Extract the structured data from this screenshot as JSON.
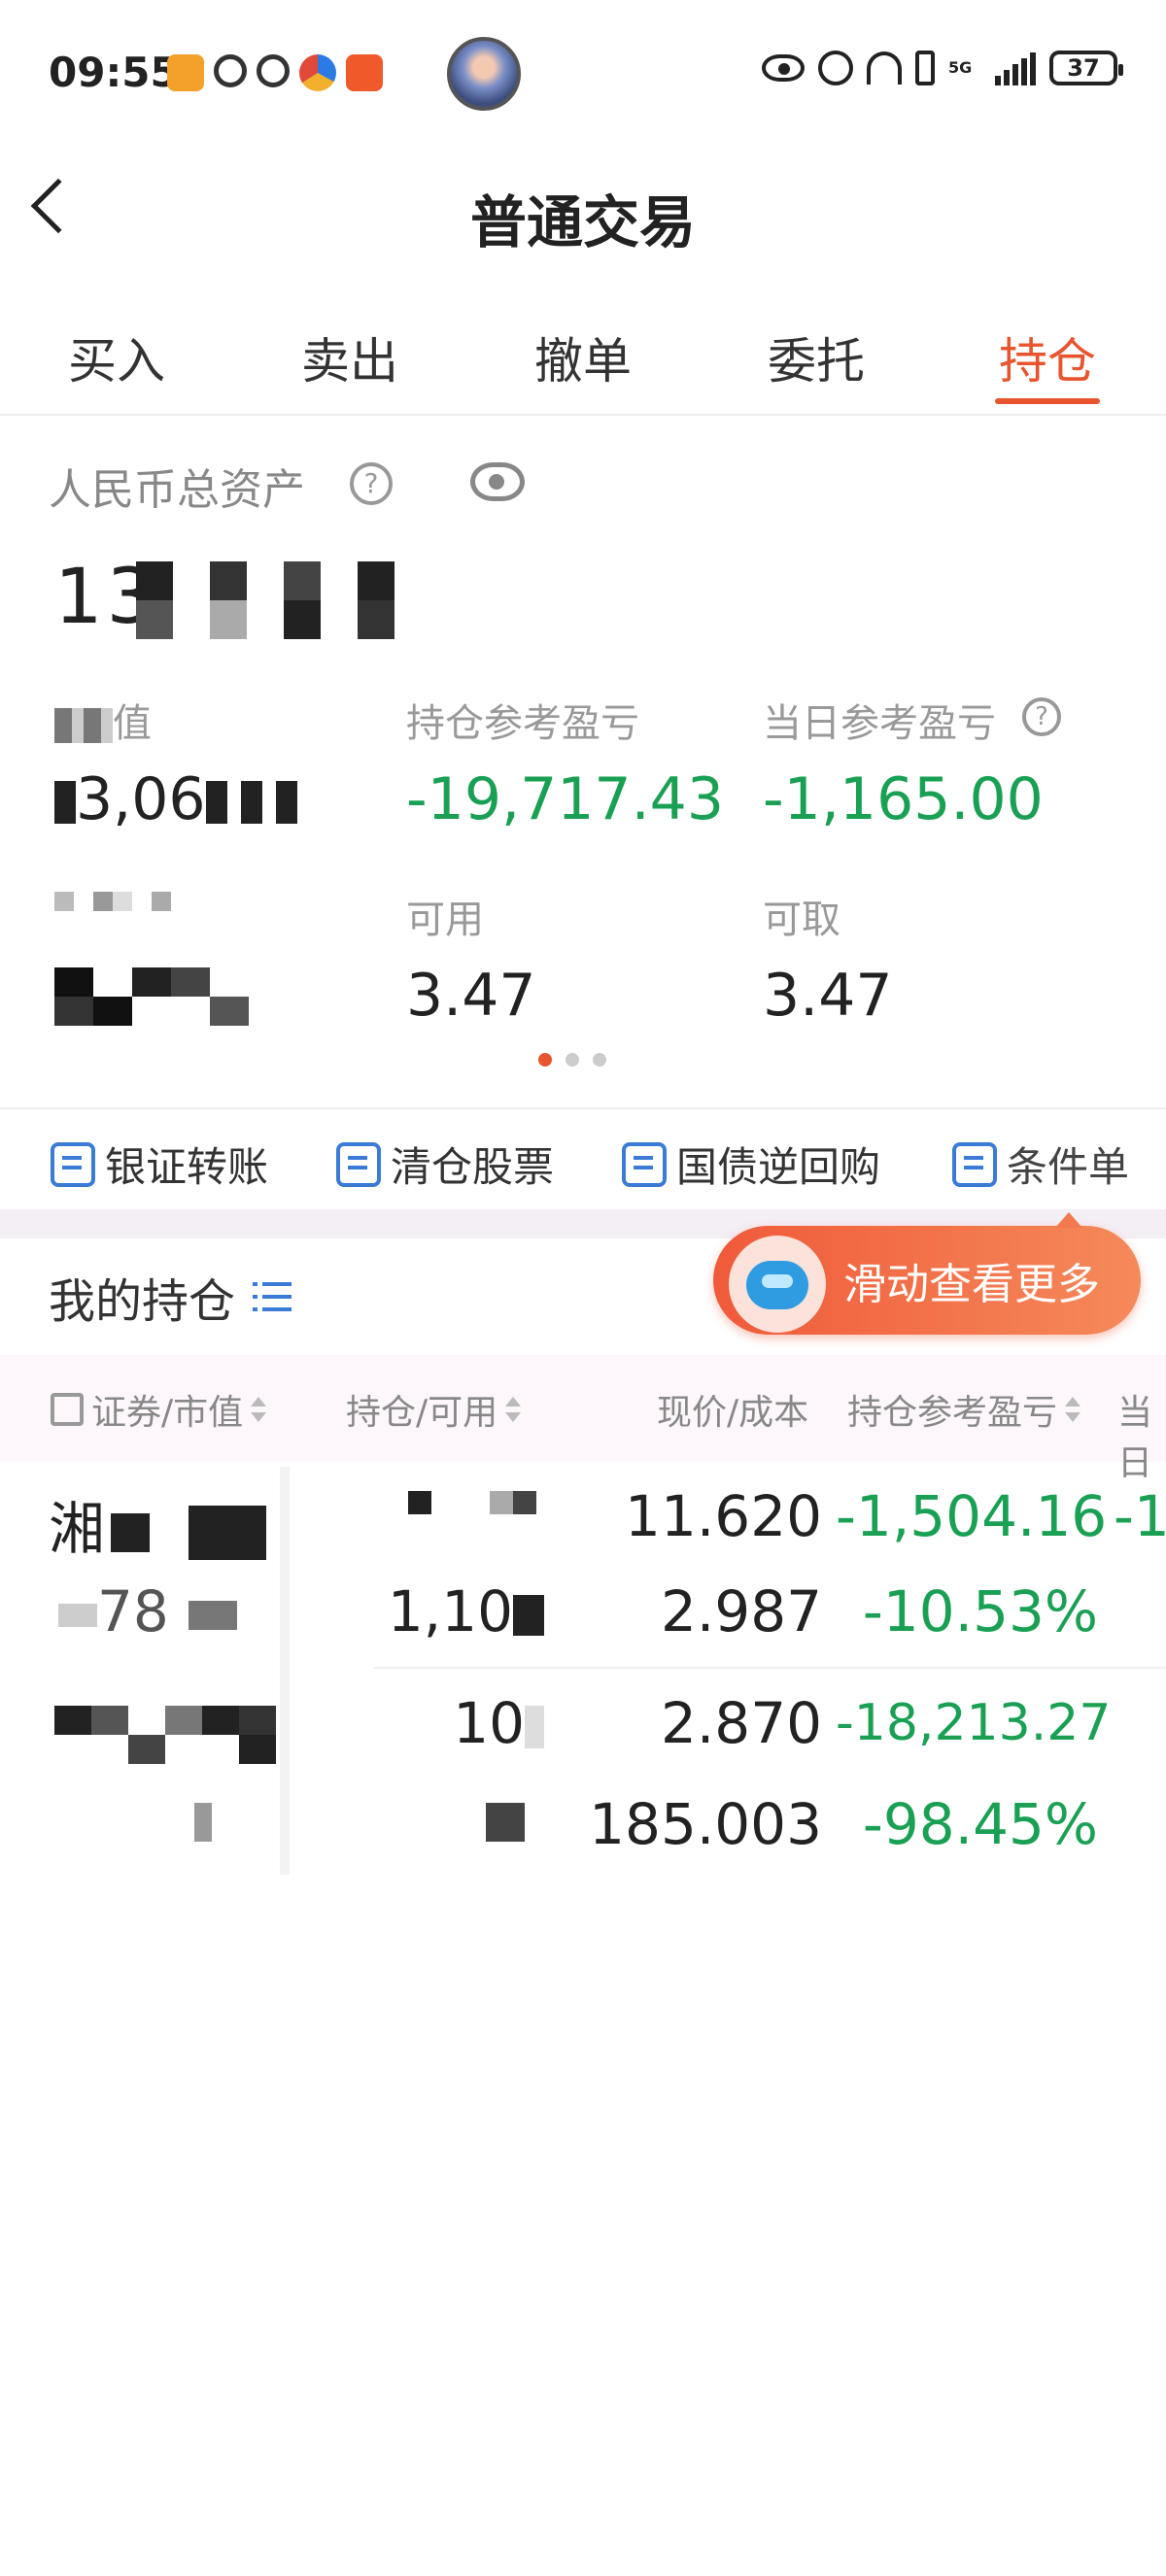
{
  "status_bar": {
    "time": "09:55",
    "network": "5G",
    "battery": "37"
  },
  "header": {
    "title": "普通交易"
  },
  "tabs": [
    {
      "label": "买入"
    },
    {
      "label": "卖出"
    },
    {
      "label": "撤单"
    },
    {
      "label": "委托"
    },
    {
      "label": "持仓",
      "active": true
    }
  ],
  "assets": {
    "label": "人民币总资产",
    "total": "13",
    "metrics": {
      "market_value": {
        "label": "值",
        "value": "3,06"
      },
      "position_pnl": {
        "label": "持仓参考盈亏",
        "value": "-19,717.43"
      },
      "daily_pnl": {
        "label": "当日参考盈亏",
        "value": "-1,165.00"
      },
      "available": {
        "label": "可用",
        "value": "3.47"
      },
      "withdrawable": {
        "label": "可取",
        "value": "3.47"
      }
    }
  },
  "actions": [
    {
      "label": "银证转账",
      "icon": "transfer-icon"
    },
    {
      "label": "清仓股票",
      "icon": "chart-icon"
    },
    {
      "label": "国债逆回购",
      "icon": "exchange-icon"
    },
    {
      "label": "条件单",
      "icon": "document-icon"
    }
  ],
  "holdings": {
    "title": "我的持仓",
    "tip": "滑动查看更多",
    "columns": [
      "证券/市值",
      "持仓/可用",
      "现价/成本",
      "持仓参考盈亏",
      "当日"
    ],
    "rows": [
      {
        "name": "湘",
        "market_value": "78",
        "position": "",
        "available": "1,10",
        "price": "11.620",
        "cost": "2.987",
        "pnl": "-1,504.16",
        "pnl_pct": "-10.53%",
        "daily_partial": "-1"
      },
      {
        "name": "",
        "market_value": "",
        "position": "10",
        "available": "",
        "price": "2.870",
        "cost": "185.003",
        "pnl": "-18,213.27",
        "pnl_pct": "-98.45%"
      }
    ]
  },
  "colors": {
    "accent": "#e8542e",
    "negative": "#1aa053",
    "link": "#3a7bd5"
  }
}
